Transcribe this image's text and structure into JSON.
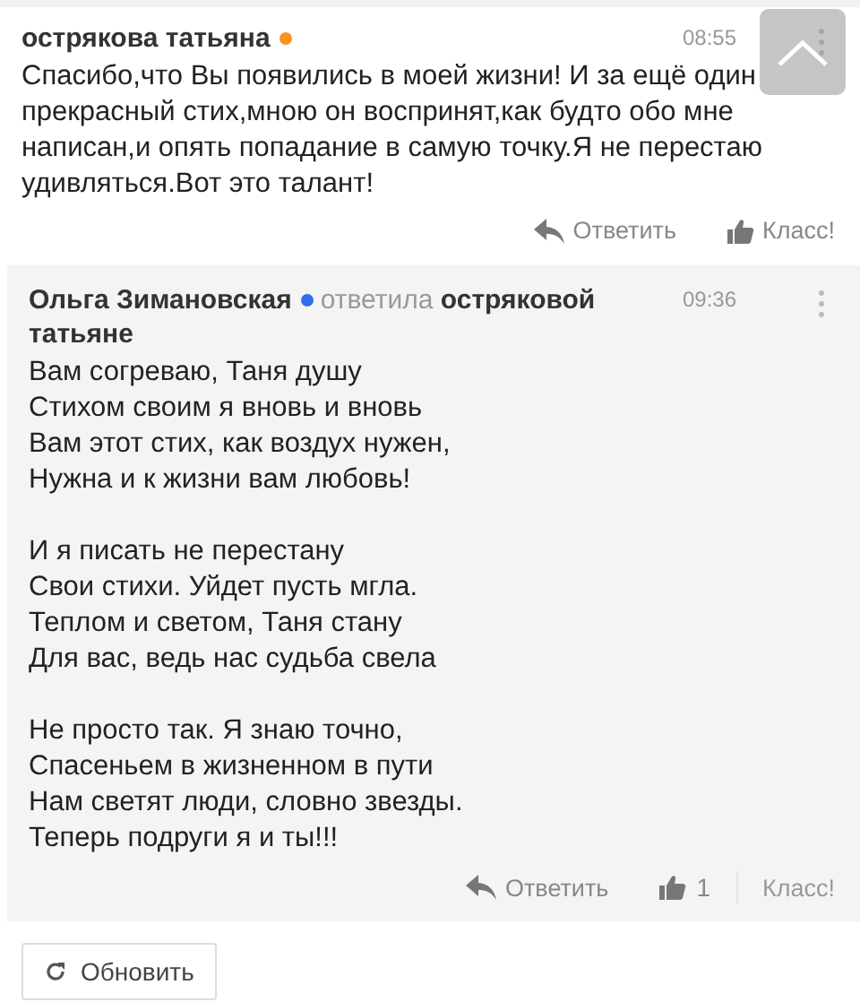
{
  "comments": [
    {
      "author": "острякова татьяна",
      "color": "#f7931e",
      "time": "08:55",
      "highlighted": false,
      "stanzas": [
        [
          "Спасибо,что Вы появились в моей жизни! И за ещё один прекрасный стих,мною он воспринят,как будто обо мне написан,и опять попадание в самую точку.Я не перестаю удивляться.Вот это талант!"
        ]
      ],
      "reply_label": "Ответить",
      "like_label": "Класс!"
    },
    {
      "author": "Ольга Зимановская",
      "color": "#2f6fed",
      "replied_word": "ответила",
      "replied_to": [
        "остряковой",
        "татьяне"
      ],
      "time": "09:36",
      "highlighted": true,
      "stanzas": [
        [
          "Вам согреваю, Таня душу",
          "Стихом своим я вновь и вновь",
          "Вам этот стих, как воздух нужен,",
          "Нужна и к жизни вам любовь!"
        ],
        [
          "И я писать не перестану",
          "Свои стихи. Уйдет пусть мгла.",
          "Теплом и светом, Таня стану",
          "Для вас, ведь нас судьба свела"
        ],
        [
          "Не просто так. Я знаю точно,",
          "Спасеньем в жизненном в пути",
          "Нам светят люди, словно звезды.",
          "Теперь подруги я и ты!!!"
        ]
      ],
      "reply_label": "Ответить",
      "like_count": "1",
      "like_label": "Класс!"
    }
  ],
  "refresh_label": "Обновить"
}
